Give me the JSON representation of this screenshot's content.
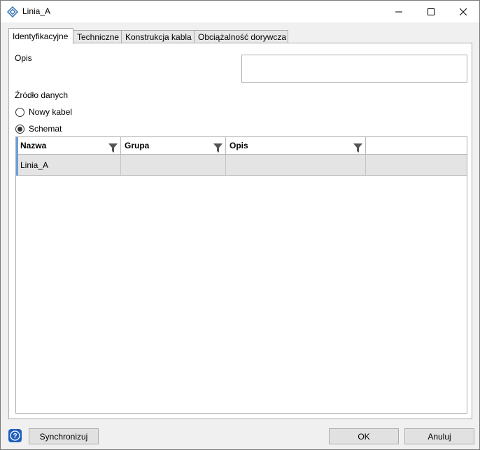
{
  "window": {
    "title": "Linia_A"
  },
  "tabs": [
    {
      "label": "Identyfikacyjne"
    },
    {
      "label": "Techniczne"
    },
    {
      "label": "Konstrukcja kabla"
    },
    {
      "label": "Obciążalność dorywcza"
    }
  ],
  "form": {
    "opis_label": "Opis",
    "opis_value": "",
    "source_label": "Źródło danych",
    "radio_new_cable": "Nowy kabel",
    "radio_schemat": "Schemat",
    "selected_source": "Schemat"
  },
  "grid": {
    "columns": [
      "Nazwa",
      "Grupa",
      "Opis"
    ],
    "rows": [
      [
        "Linia_A",
        "",
        ""
      ]
    ]
  },
  "footer": {
    "sync_label": "Synchronizuj",
    "ok_label": "OK",
    "cancel_label": "Anuluj"
  },
  "colors": {
    "accent": "#6d9ed6",
    "help_icon": "#1f5fbf"
  }
}
